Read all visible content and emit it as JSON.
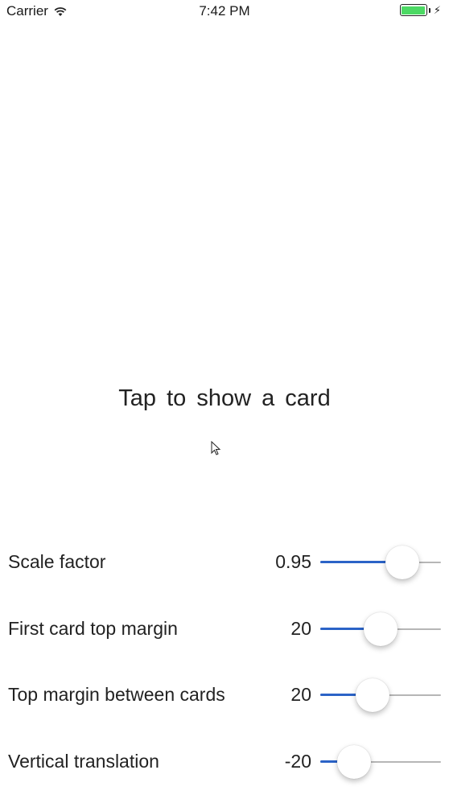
{
  "status_bar": {
    "carrier": "Carrier",
    "time": "7:42 PM",
    "wifi_icon": "wifi-icon",
    "battery_icon": "battery-icon",
    "battery_color": "#4cd964"
  },
  "main": {
    "tap_label": "Tap to show a card"
  },
  "controls": [
    {
      "label": "Scale factor",
      "value": "0.95",
      "slider_fraction": 0.68
    },
    {
      "label": "First card top margin",
      "value": "20",
      "slider_fraction": 0.5
    },
    {
      "label": "Top margin between cards",
      "value": "20",
      "slider_fraction": 0.43
    },
    {
      "label": "Vertical translation",
      "value": "-20",
      "slider_fraction": 0.28
    }
  ],
  "colors": {
    "slider_fill": "#2b63c7",
    "slider_track": "#b6b6b6"
  }
}
